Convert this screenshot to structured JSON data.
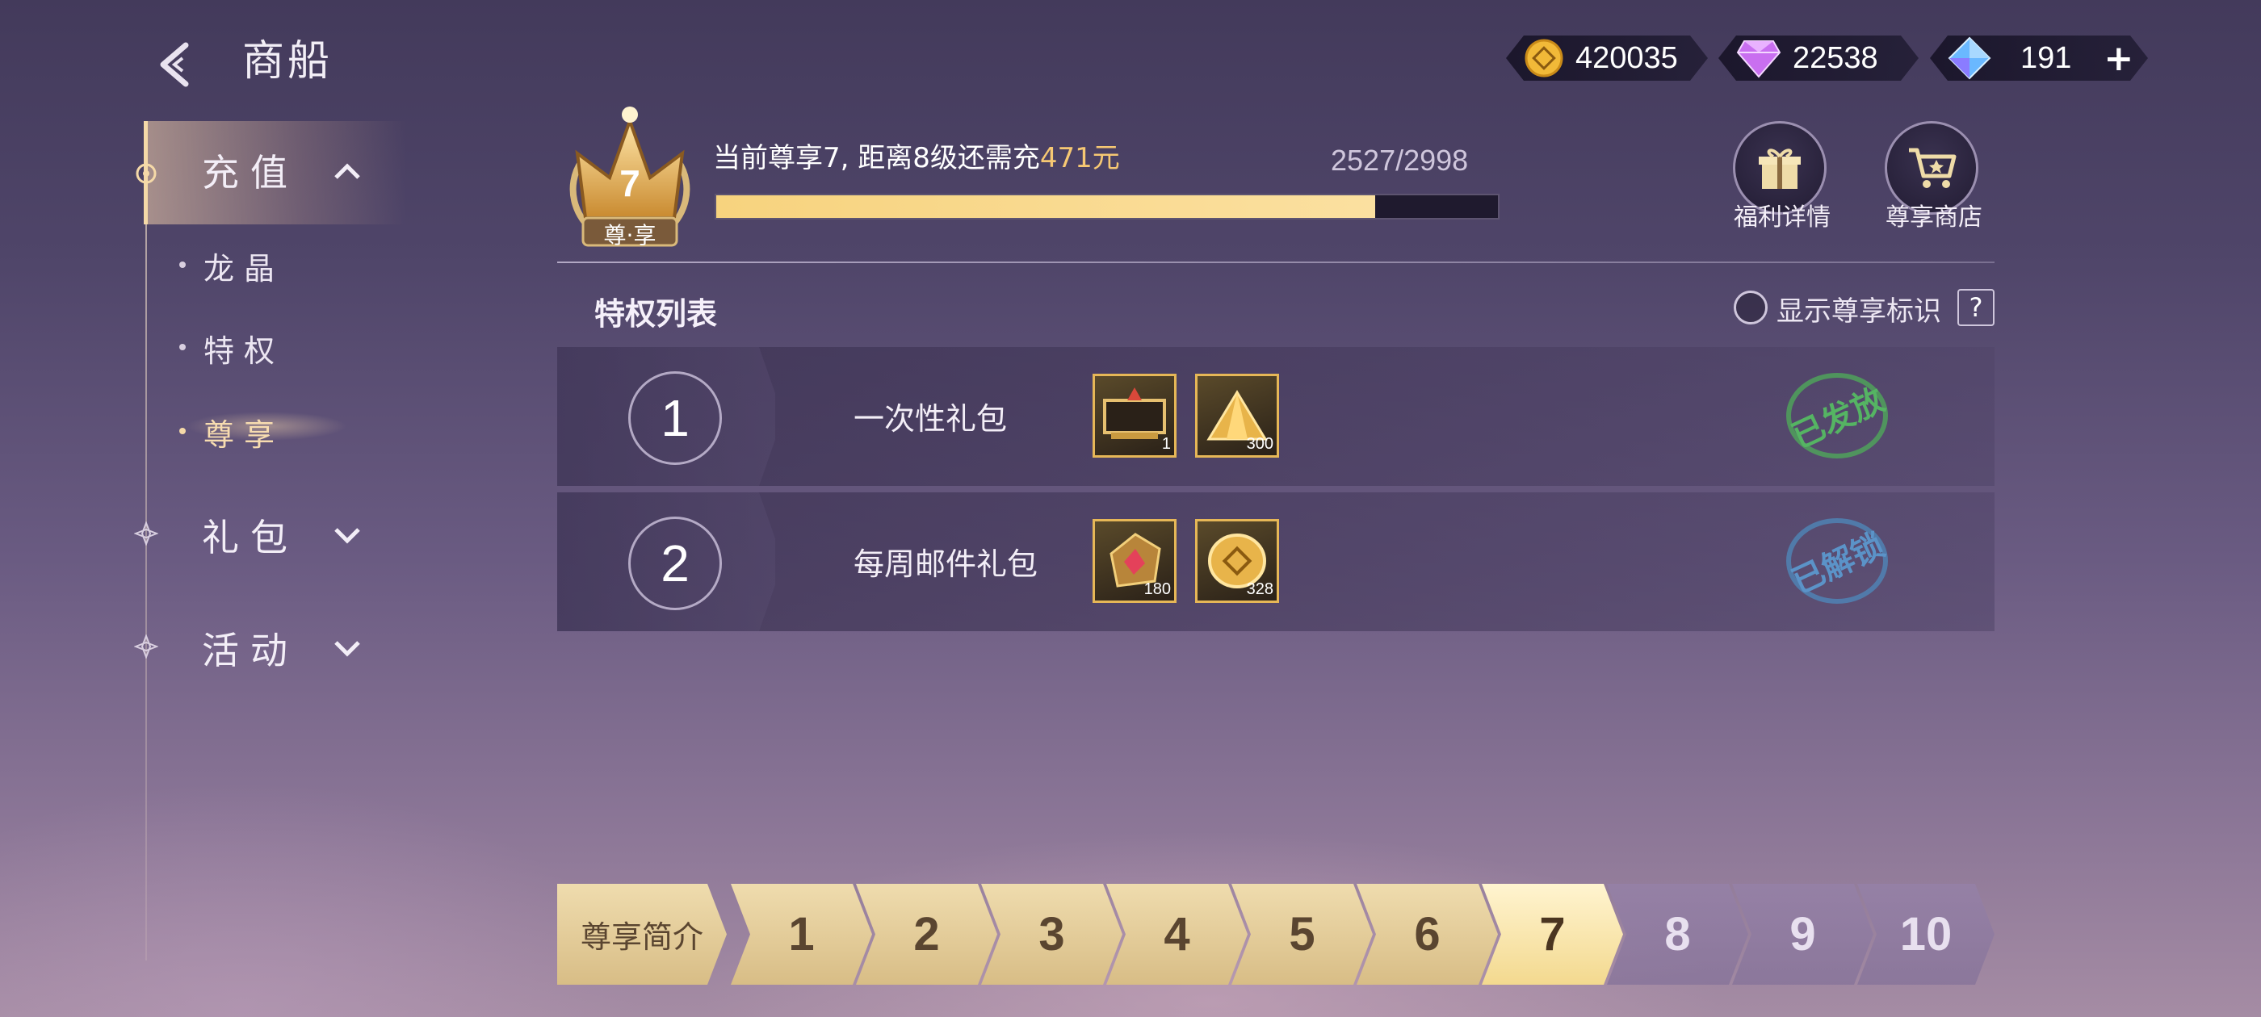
{
  "header": {
    "title": "商船",
    "currencies": [
      {
        "icon": "gold-coin-icon",
        "value": "420035"
      },
      {
        "icon": "purple-diamond-icon",
        "value": "22538"
      },
      {
        "icon": "blue-crystal-icon",
        "value": "191"
      }
    ],
    "add_symbol": "+"
  },
  "sidebar": {
    "recharge": "充值",
    "sub_items": [
      "龙晶",
      "特权",
      "尊享"
    ],
    "gift": "礼包",
    "activity": "活动"
  },
  "vip": {
    "level": "7",
    "badge_label": "尊·享",
    "status_prefix": "当前尊享7, 距离8级还需充",
    "status_amount": "471元",
    "progress_text": "2527/2998",
    "progress_fraction": 0.843,
    "buttons": [
      "福利详情",
      "尊享商店"
    ]
  },
  "privileges": {
    "title": "特权列表",
    "toggle_label": "显示尊享标识",
    "help": "?",
    "rows": [
      {
        "num": "1",
        "name": "一次性礼包",
        "items": [
          {
            "icon": "treasure-frame-icon",
            "qty": "1"
          },
          {
            "icon": "gold-pile-icon",
            "qty": "300"
          }
        ],
        "status": "已发放",
        "status_color": "#4fa85a"
      },
      {
        "num": "2",
        "name": "每周邮件礼包",
        "items": [
          {
            "icon": "red-gem-icon",
            "qty": "180"
          },
          {
            "icon": "gold-coin-icon",
            "qty": "328"
          }
        ],
        "status": "已解锁",
        "status_color": "#4f86b8"
      }
    ]
  },
  "levels": {
    "intro": "尊享简介",
    "items": [
      "1",
      "2",
      "3",
      "4",
      "5",
      "6",
      "7",
      "8",
      "9",
      "10"
    ],
    "current": "7"
  }
}
